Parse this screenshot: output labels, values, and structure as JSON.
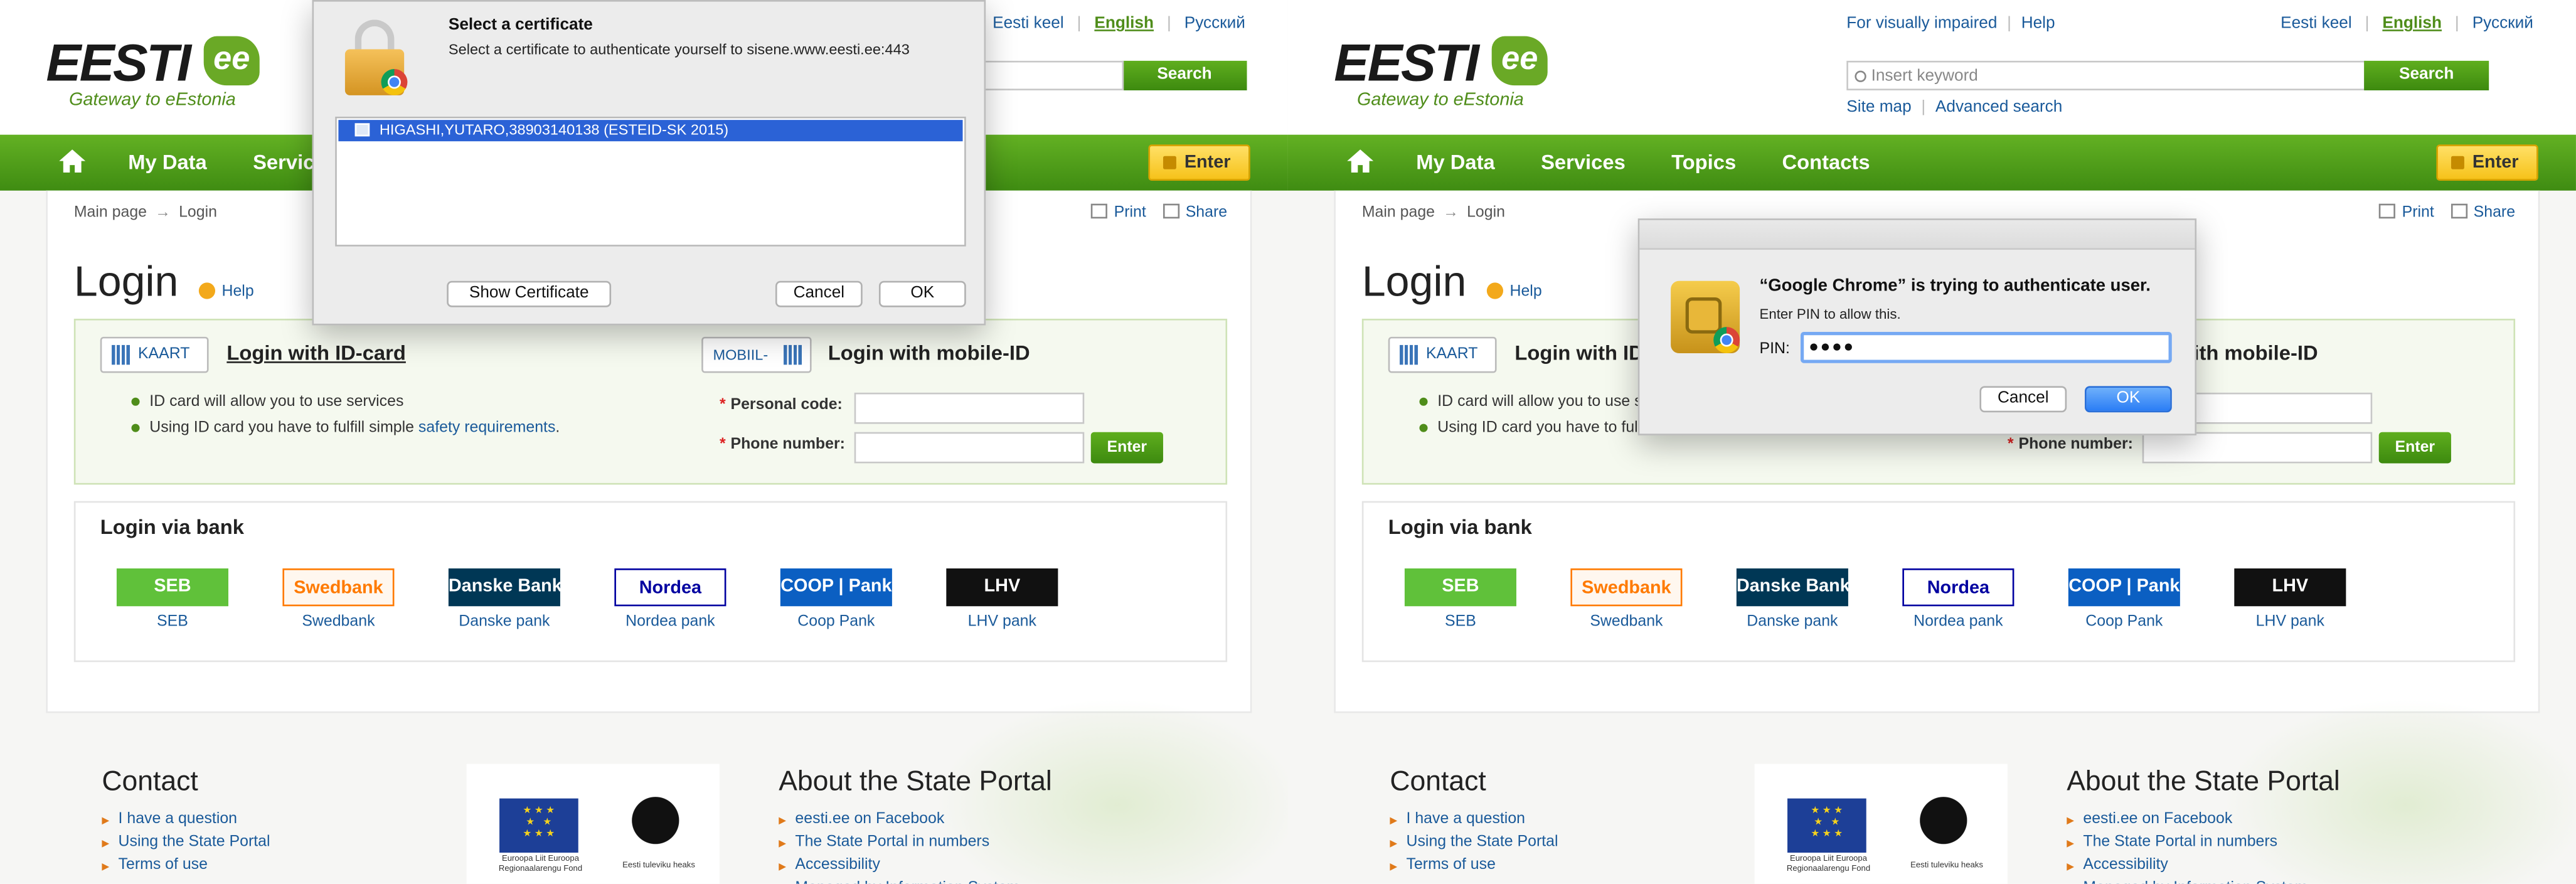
{
  "site": {
    "logo_word": "EESTI",
    "logo_ee": "ee",
    "logo_tagline": "Gateway to eEstonia",
    "languages": [
      "Eesti keel",
      "English",
      "Русский"
    ],
    "top_links": [
      "For visually impaired",
      "Help"
    ],
    "search_placeholder": "Insert keyword",
    "search_button": "Search",
    "sub_links": [
      "Site map",
      "Advanced search"
    ],
    "nav": [
      "My Data",
      "Services",
      "Topics",
      "Contacts"
    ],
    "enter_button": "Enter",
    "breadcrumb": [
      "Main page",
      "Login"
    ],
    "print": "Print",
    "share": "Share",
    "page_title": "Login",
    "help": "Help",
    "id_badge": "KAART",
    "id_title": "Login with ID-card",
    "id_bullets": [
      "ID card will allow you to use services",
      "Using ID card you have to fulfill simple"
    ],
    "id_bullet_link": "safety requirements",
    "mobile_badge": "MOBIIL-",
    "mobile_title": "Login with mobile-ID",
    "personal_code_label": "Personal code:",
    "phone_label": "Phone number:",
    "mobile_enter": "Enter",
    "bank_title": "Login via bank",
    "banks": [
      {
        "logo": "SEB",
        "name": "SEB",
        "color": "#60c13a"
      },
      {
        "logo": "Swedbank",
        "name": "Swedbank",
        "color": "#ff7a00"
      },
      {
        "logo": "Danske Bank",
        "name": "Danske pank",
        "color": "#003755"
      },
      {
        "logo": "Nordea",
        "name": "Nordea pank",
        "color": "#0000a0"
      },
      {
        "logo": "COOP | Pank",
        "name": "Coop Pank",
        "color": "#0b5fc2"
      },
      {
        "logo": "LHV",
        "name": "LHV pank",
        "color": "#111111"
      }
    ],
    "contact_title": "Contact",
    "contact_links": [
      "I have a question",
      "Using the State Portal",
      "Terms of use"
    ],
    "eu_text": "Euroopa Liit Euroopa Regionaalarengu Fond",
    "estonia_text": "Eesti tuleviku heaks",
    "about_title": "About the State Portal",
    "about_links": [
      "eesti.ee on Facebook",
      "The State Portal in numbers",
      "Accessibility",
      "Managed by Information System"
    ]
  },
  "cert_dialog": {
    "title": "Select a certificate",
    "subtitle": "Select a certificate to authenticate yourself to sisene.www.eesti.ee:443",
    "selected_cert": "HIGASHI,YUTARO,38903140138  (ESTEID-SK 2015)",
    "show_certificate": "Show Certificate",
    "cancel": "Cancel",
    "ok": "OK"
  },
  "pin_dialog": {
    "title": "“Google Chrome” is trying to authenticate user.",
    "subtitle": "Enter PIN to allow this.",
    "pin_label": "PIN:",
    "pin_value": "●●●●",
    "cancel": "Cancel",
    "ok": "OK"
  }
}
